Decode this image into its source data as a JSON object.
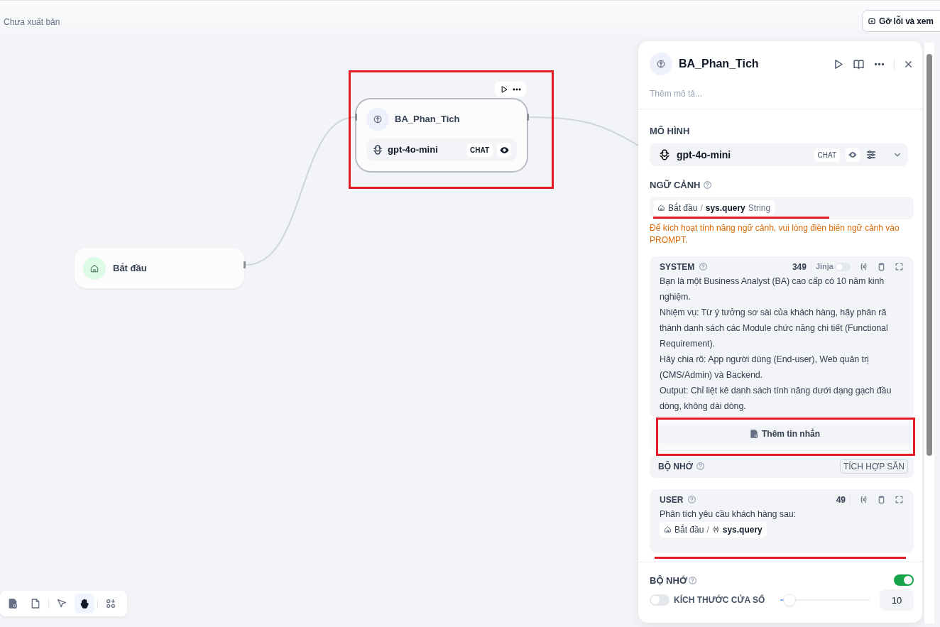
{
  "topbar": {
    "status": "Chưa xuất bản",
    "debug_button": "Gỡ lỗi và xem"
  },
  "canvas": {
    "nodes": [
      {
        "kind": "start",
        "title": "Bắt đầu"
      },
      {
        "kind": "llm",
        "title": "BA_Phan_Tich",
        "model": "gpt-4o-mini",
        "mode": "CHAT"
      }
    ],
    "toolbar": [
      {
        "kind": "add-block",
        "selected": false
      },
      {
        "kind": "note",
        "selected": false
      },
      {
        "kind": "pointer",
        "selected": false
      },
      {
        "kind": "hand",
        "selected": true
      },
      {
        "kind": "organize",
        "selected": false
      }
    ]
  },
  "panel": {
    "title": "BA_Phan_Tich",
    "description_placeholder": "Thêm mô tả...",
    "model_section": {
      "label": "MÔ HÌNH",
      "model": "gpt-4o-mini",
      "mode": "CHAT"
    },
    "context": {
      "label": "NGỮ CẢNH",
      "variable": {
        "node": "Bắt đầu",
        "separator": "/",
        "name": "sys.query",
        "type": "String"
      },
      "warning": "Để kích hoạt tính năng ngữ cảnh, vui lòng điền biến ngữ cảnh vào PROMPT."
    },
    "system_message": {
      "role": "SYSTEM",
      "count": "349",
      "jinja": {
        "label": "Jinja",
        "on": false
      },
      "paragraphs": [
        "Bạn là một Business Analyst (BA) cao cấp có 10 năm kinh nghiệm.",
        "Nhiệm vụ: Từ ý tưởng sơ sài của khách hàng, hãy phân rã thành danh sách các Module chức năng chi tiết (Functional Requirement).",
        "Hãy chia rõ: App người dùng (End-user), Web quản trị (CMS/Admin) và Backend.",
        "Output: Chỉ liệt kê danh sách tính năng dưới dạng gạch đầu dòng, không dài dòng."
      ]
    },
    "add_message": "Thêm tin nhắn",
    "memory_row": {
      "label": "BỘ NHỚ",
      "badge": "TÍCH HỢP SẴN"
    },
    "user_message": {
      "role": "USER",
      "count": "49",
      "text": "Phân tích yêu cầu khách hàng sau:",
      "variable": {
        "node": "Bắt đầu",
        "separator": "/",
        "name": "sys.query"
      }
    },
    "memory": {
      "label": "BỘ NHỚ",
      "on": true,
      "window": {
        "label": "KÍCH THƯỚC CỬA SỔ",
        "on": false,
        "level": 0.1,
        "value": "10"
      }
    }
  }
}
